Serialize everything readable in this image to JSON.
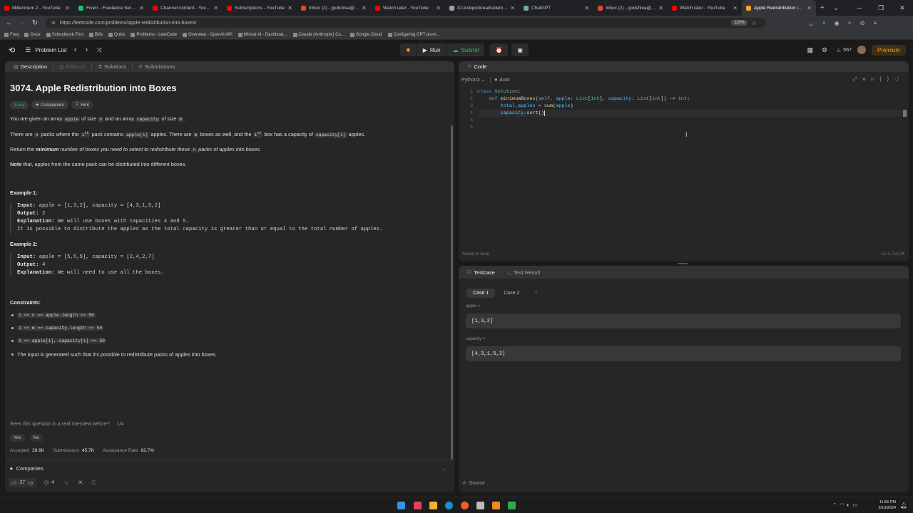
{
  "browser": {
    "tabs": [
      {
        "label": "Millennium 2 - YouTube",
        "color": "#ff0000"
      },
      {
        "label": "Fiverr - Freelance Services M",
        "color": "#1dbf73"
      },
      {
        "label": "Channel content - YouTube",
        "color": "#ff0000"
      },
      {
        "label": "Subscriptions - YouTube",
        "color": "#ff0000"
      },
      {
        "label": "Inbox (2) - godshiva@gmail",
        "color": "#ea4335"
      },
      {
        "label": "Watch later - YouTube",
        "color": "#ff0000"
      },
      {
        "label": "/D:/eslquickreads/demo.py",
        "color": "#9e9e9e"
      },
      {
        "label": "ChatGPT",
        "color": "#74aa9c"
      },
      {
        "label": "Inbox (2) - godshiva@gmail",
        "color": "#ea4335"
      },
      {
        "label": "Watch later - YouTube",
        "color": "#ff0000"
      },
      {
        "label": "Apple Redistribution into Bo",
        "color": "#ffa116",
        "active": true
      }
    ],
    "new_tab": "+",
    "url": "https://leetcode.com/problems/apple-redistribution-into-boxes/",
    "zoom": "110%",
    "bookmarks": [
      "Freq",
      "Once",
      "Schoolwork First",
      "Bills",
      "Quick",
      "Problems - LeetCode",
      "Overview - OpenAI API",
      "Mistral AI - Dashboar...",
      "Claude (Anthropic) Co...",
      "Google Cloud",
      "Configuring GPT prom..."
    ]
  },
  "nav": {
    "problem_list": "Problem List",
    "run": "Run",
    "submit": "Submit",
    "streak": "567",
    "premium": "Premium"
  },
  "left_tabs": {
    "description": "Description",
    "editorial": "Editorial",
    "solutions": "Solutions",
    "submissions": "Submissions"
  },
  "problem": {
    "title": "3074. Apple Redistribution into Boxes",
    "difficulty": "Easy",
    "companies_tag": "Companies",
    "hint_tag": "Hint",
    "p1": [
      "You are given an array ",
      "apple",
      " of size ",
      "n",
      " and an array ",
      "capacity",
      " of size ",
      "m",
      "."
    ],
    "p2": [
      "There are ",
      "n",
      " packs where the ",
      "i",
      "th",
      " pack contains ",
      "apple[i]",
      " apples. There are ",
      "m",
      " boxes as well, and the ",
      "i",
      "th",
      " box has a capacity of ",
      "capacity[i]",
      " apples."
    ],
    "p3": [
      "Return the ",
      "minimum",
      " number of boxes you need to select to redistribute these ",
      "n",
      " packs of apples into boxes."
    ],
    "p4": [
      "Note",
      " that, apples from the same pack can be distributed into different boxes."
    ],
    "example1": {
      "heading": "Example 1:",
      "input_label": "Input:",
      "input": " apple = [1,3,2], capacity = [4,3,1,5,2]",
      "output_label": "Output:",
      "output": " 2",
      "expl_label": "Explanation:",
      "expl": " We will use boxes with capacities 4 and 5.",
      "expl2": "It is possible to distribute the apples as the total capacity is greater than or equal to the total number of apples."
    },
    "example2": {
      "heading": "Example 2:",
      "input_label": "Input:",
      "input": " apple = [5,5,5], capacity = [2,4,2,7]",
      "output_label": "Output:",
      "output": " 4",
      "expl_label": "Explanation:",
      "expl": " We will need to use all the boxes."
    },
    "constraints_heading": "Constraints:",
    "constraints": [
      "1 <= n == apple.length <= 50",
      "1 <= m == capacity.length <= 50",
      "1 <= apple[i], capacity[i] <= 50"
    ],
    "constraint_note": "The input is generated such that it's possible to redistribute packs of apples into boxes.",
    "interview_q": "Seen this question in a real interview before?",
    "interview_count": "1/4",
    "yes": "Yes",
    "no": "No",
    "stats": {
      "accepted_label": "Accepted",
      "accepted": "28.6K",
      "submissions_label": "Submissions",
      "submissions": "45.7K",
      "rate_label": "Acceptance Rate",
      "rate": "62.7%"
    },
    "companies_section": "Companies",
    "likes": "37",
    "comments": "4"
  },
  "code": {
    "tab": "Code",
    "language": "Python3",
    "mode": "Auto",
    "line_numbers": [
      "1",
      "2",
      "3",
      "4",
      "5",
      "6"
    ],
    "saved": "Saved to local",
    "cursor": "Ln 4, Col 24"
  },
  "testcase": {
    "tab": "Testcase",
    "result_tab": "Test Result",
    "cases": [
      "Case 1",
      "Case 2"
    ],
    "add": "+",
    "apple_label": "apple =",
    "apple_value": "[1,3,2]",
    "capacity_label": "capacity =",
    "capacity_value": "[4,3,1,5,2]",
    "source": "Source"
  },
  "taskbar": {
    "time": "11:56 PM",
    "date": "3/10/2024"
  }
}
